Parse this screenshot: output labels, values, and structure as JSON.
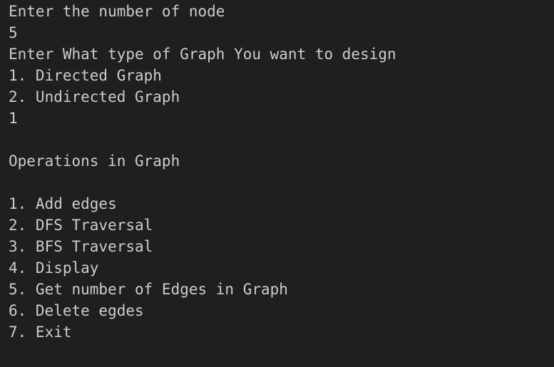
{
  "terminal": {
    "lines": [
      "Enter the number of node",
      "5",
      "Enter What type of Graph You want to design",
      "1. Directed Graph",
      "2. Undirected Graph",
      "1",
      "",
      "Operations in Graph",
      "",
      "1. Add edges",
      "2. DFS Traversal",
      "3. BFS Traversal",
      "4. Display",
      "5. Get number of Edges in Graph",
      "6. Delete egdes",
      "7. Exit"
    ]
  }
}
